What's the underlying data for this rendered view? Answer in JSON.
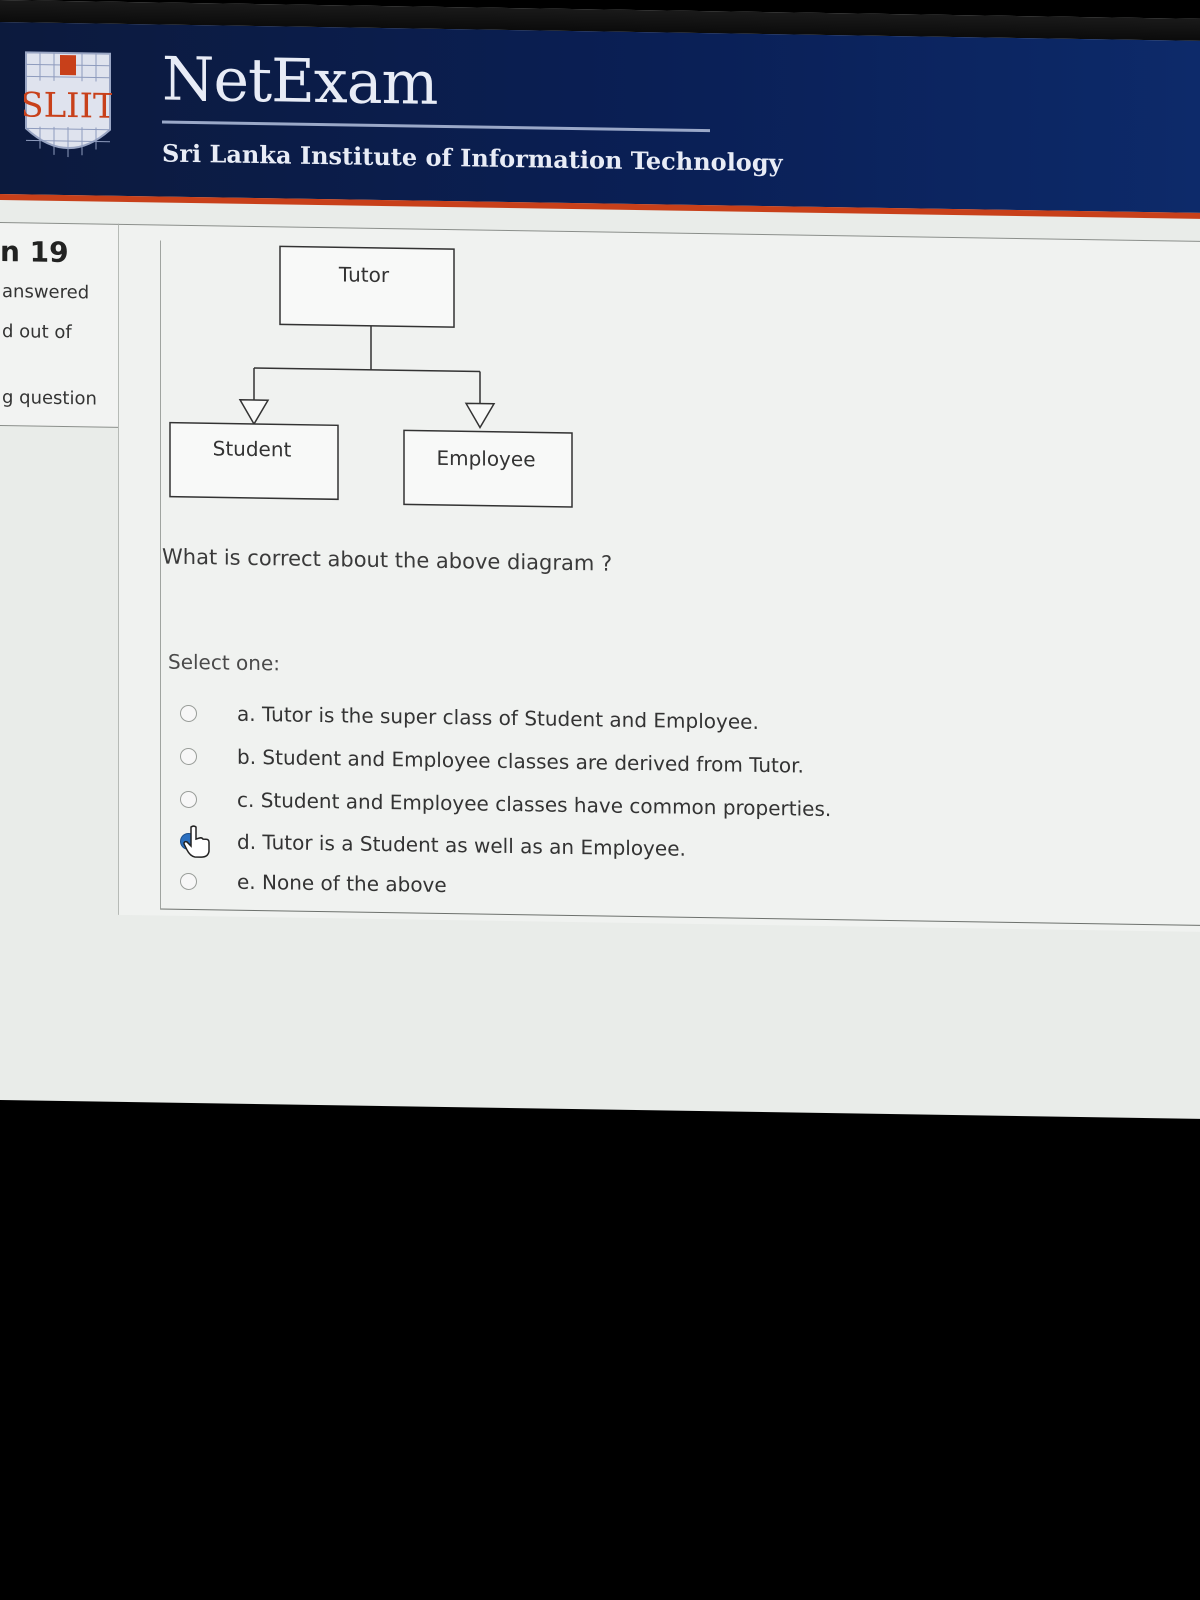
{
  "header": {
    "logo_text": "SLIIT",
    "brand": "NetExam",
    "subtitle": "Sri Lanka Institute of Information Technology",
    "accent_color": "#c8401a"
  },
  "sidebar": {
    "question_number": "n 19",
    "status": "answered",
    "marks": "d out of",
    "flag": "g question"
  },
  "diagram": {
    "superclass": "Tutor",
    "subclasses": [
      "Student",
      "Employee"
    ]
  },
  "question": {
    "prompt": "What is correct about the above diagram ?",
    "select_label": "Select one:",
    "options": [
      {
        "label": "a. Tutor is the super class of Student and Employee.",
        "selected": false
      },
      {
        "label": "b. Student and Employee classes are derived from Tutor.",
        "selected": false
      },
      {
        "label": "c. Student and Employee classes have common properties.",
        "selected": false
      },
      {
        "label": "d. Tutor is a Student as well as an Employee.",
        "selected": true
      },
      {
        "label": "e. None of the above",
        "selected": false
      }
    ]
  }
}
